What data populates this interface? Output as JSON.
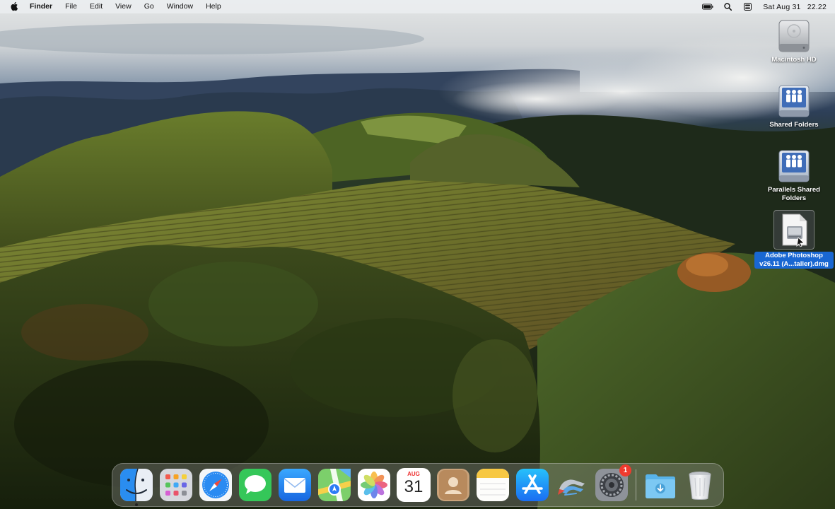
{
  "menubar": {
    "app_name": "Finder",
    "menus": [
      "File",
      "Edit",
      "View",
      "Go",
      "Window",
      "Help"
    ],
    "status_icons": [
      "battery-icon",
      "search-icon",
      "control-center-icon"
    ],
    "date": "Sat Aug 31",
    "time": "22.22"
  },
  "desktop_icons": [
    {
      "label": "Macintosh HD",
      "icon": "hard-drive-icon"
    },
    {
      "label": "Shared Folders",
      "icon": "shared-folder-icon"
    },
    {
      "label": "Parallels Shared Folders",
      "icon": "shared-folder-icon"
    },
    {
      "label": "Adobe Photoshop v26.11 (A...taller).dmg",
      "icon": "disk-image-icon",
      "selected": true
    }
  ],
  "dock": {
    "apps": [
      "Finder",
      "Launchpad",
      "Safari",
      "Messages",
      "Mail",
      "Maps",
      "Photos",
      "Calendar",
      "Contacts",
      "Notes",
      "App Store",
      "Parallels Desktop",
      "System Settings",
      "Downloads",
      "Trash"
    ],
    "calendar": {
      "month": "AUG",
      "day": "31"
    },
    "settings_badge": "1"
  },
  "colors": {
    "menubar": "#eceef0",
    "selection": "#1967d2",
    "badge": "#f03a2e"
  }
}
